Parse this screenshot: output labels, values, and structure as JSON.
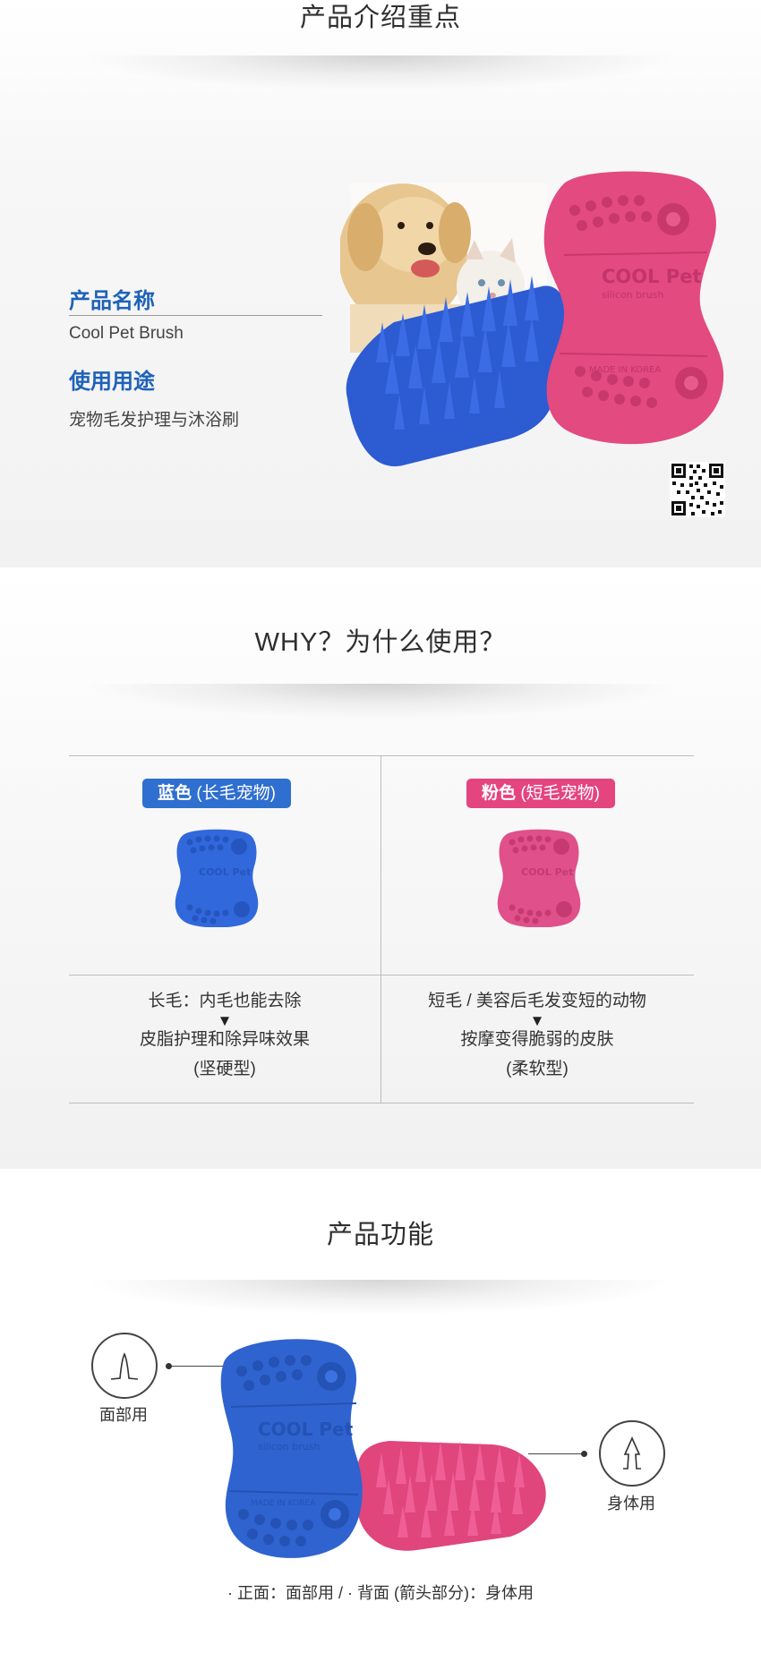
{
  "intro": {
    "title": "产品介绍重点",
    "name_label": "产品名称",
    "name_value": "Cool Pet Brush",
    "use_label": "使用用途",
    "use_value": "宠物毛发护理与沐浴刷",
    "brush_logo": "COOL Pet",
    "brush_sub": "silicon brush",
    "brush_made": "MADE IN KOREA",
    "icons": [
      "dog-cat-photo",
      "qr-code-icon"
    ]
  },
  "why": {
    "title": "WHY？为什么使用？",
    "blue": {
      "badge_bold": "蓝色",
      "badge_rest": "(长毛宠物)",
      "color": "#2f6fd0",
      "line1": "长毛：内毛也能去除",
      "arrow": "▼",
      "line2": "皮脂护理和除异味效果",
      "line3": "(坚硬型)"
    },
    "pink": {
      "badge_bold": "粉色",
      "badge_rest": "(短毛宠物)",
      "color": "#e4457f",
      "line1": "短毛 / 美容后毛发变短的动物",
      "arrow": "▼",
      "line2": "按摩变得脆弱的皮肤",
      "line3": "(柔软型)"
    }
  },
  "features": {
    "title": "产品功能",
    "face_label": "面部用",
    "body_label": "身体用",
    "caption": "· 正面：面部用 / · 背面 (箭头部分)：身体用"
  },
  "colors": {
    "blue_brush": "#2f63d0",
    "pink_brush": "#e0457c",
    "title_blue": "#1e62b8"
  }
}
